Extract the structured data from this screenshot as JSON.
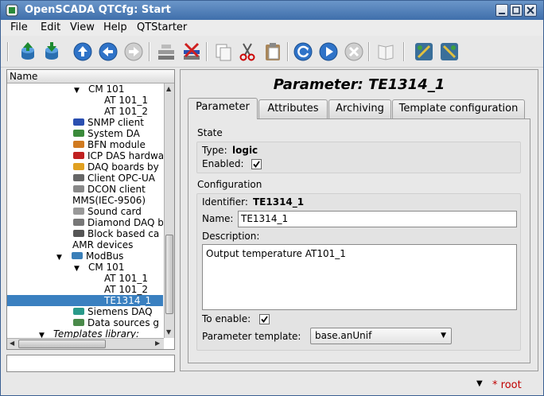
{
  "window": {
    "title": "OpenSCADA QTCfg: Start"
  },
  "menubar": [
    "File",
    "Edit",
    "View",
    "Help",
    "QTStarter"
  ],
  "toolbar": {
    "icons": [
      "db-load-icon",
      "db-save-icon",
      "up-icon",
      "back-icon",
      "forward-icon",
      "add-item-icon",
      "delete-item-icon",
      "copy-icon",
      "cut-icon",
      "paste-icon",
      "refresh-icon",
      "start-icon",
      "stop-icon",
      "manual-icon",
      "tools-icon-1",
      "tools-icon-2"
    ]
  },
  "tree": {
    "header": "Name",
    "rows": [
      {
        "label": "CM 101",
        "arrow": "▼",
        "indent": 1
      },
      {
        "label": "AT 101_1",
        "indent": 3
      },
      {
        "label": "AT 101_2",
        "indent": 3
      },
      {
        "label": "SNMP client",
        "indent": 2,
        "icon": "snmp"
      },
      {
        "label": "System DA",
        "indent": 2,
        "icon": "system"
      },
      {
        "label": "BFN module",
        "indent": 2,
        "icon": "bfn"
      },
      {
        "label": "ICP DAS hardwa",
        "indent": 2,
        "icon": "icpdas"
      },
      {
        "label": "DAQ boards by",
        "indent": 2,
        "icon": "daq"
      },
      {
        "label": "Client OPC-UA",
        "indent": 2,
        "icon": "opc"
      },
      {
        "label": "DCON client",
        "indent": 2,
        "icon": "dcon"
      },
      {
        "label": "MMS(IEC-9506)",
        "indent": 0
      },
      {
        "label": "Sound card",
        "indent": 2,
        "icon": "sound"
      },
      {
        "label": "Diamond DAQ b",
        "indent": 2,
        "icon": "diamond"
      },
      {
        "label": "Block based ca",
        "indent": 2,
        "icon": "block"
      },
      {
        "label": "AMR devices",
        "indent": 0
      },
      {
        "label": "ModBus",
        "arrow": "▼",
        "indent": 0,
        "icon": "modbus"
      },
      {
        "label": "CM 101",
        "arrow": "▼",
        "indent": 1
      },
      {
        "label": "AT 101_1",
        "indent": 3
      },
      {
        "label": "AT 101_2",
        "indent": 3
      },
      {
        "label": "TE1314_1",
        "indent": 3,
        "selected": true
      },
      {
        "label": "Siemens DAQ",
        "indent": 2,
        "icon": "siemens"
      },
      {
        "label": "Data sources g",
        "indent": 2,
        "icon": "datasrc"
      },
      {
        "label": "Templates library:",
        "arrow": "▼",
        "indent": -1,
        "italic": true
      }
    ]
  },
  "panel": {
    "title": "Parameter: TE1314_1",
    "tabs": [
      "Parameter",
      "Attributes",
      "Archiving",
      "Template configuration"
    ],
    "state": {
      "label": "State",
      "type_label": "Type:",
      "type_value": "logic",
      "enabled_label": "Enabled:",
      "enabled": true
    },
    "config": {
      "label": "Configuration",
      "identifier_label": "Identifier:",
      "identifier_value": "TE1314_1",
      "name_label": "Name:",
      "name_value": "TE1314_1",
      "description_label": "Description:",
      "description_value": "Output temperature AT101_1",
      "to_enable_label": "To enable:",
      "to_enable": true,
      "template_label": "Parameter template:",
      "template_value": "base.anUnif"
    }
  },
  "status": {
    "user": "root"
  }
}
